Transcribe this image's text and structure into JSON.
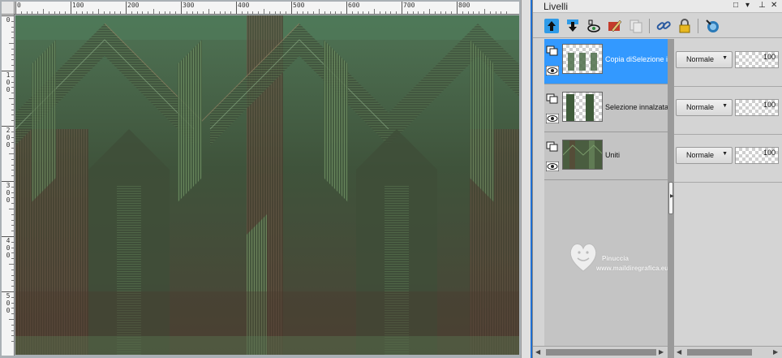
{
  "panel": {
    "title": "Livelli",
    "controls": {
      "options": "□",
      "menu": "▾",
      "pin": "⊥",
      "close": "✕"
    }
  },
  "toolbar": {
    "tools": [
      {
        "icon": "move-layer-up-icon"
      },
      {
        "icon": "move-layer-down-icon"
      },
      {
        "icon": "layer-properties-icon"
      },
      {
        "icon": "edit-selection-icon"
      },
      {
        "icon": "duplicate-layer-icon"
      },
      {
        "icon": "link-layers-icon"
      },
      {
        "icon": "lock-transparency-icon"
      },
      {
        "icon": "layer-mask-icon"
      }
    ]
  },
  "ruler": {
    "top_labels": [
      "0",
      "100",
      "200",
      "300",
      "400",
      "500",
      "600",
      "700",
      "800"
    ],
    "left_labels": [
      "0",
      "100",
      "200",
      "300",
      "400",
      "500"
    ]
  },
  "layers": [
    {
      "name": "Copia diSelezione innalzata",
      "blend_mode": "Normale",
      "opacity": "100",
      "selected": true
    },
    {
      "name": "Selezione innalzata",
      "blend_mode": "Normale",
      "opacity": "100",
      "selected": false
    },
    {
      "name": "Uniti",
      "blend_mode": "Normale",
      "opacity": "100",
      "selected": false
    }
  ],
  "watermark": {
    "name": "Pinuccia",
    "url": "www.maildiregrafica.eu"
  },
  "colors": {
    "selection": "#3399ff",
    "art_green": "#4e6b48",
    "art_brown": "#5d4334"
  }
}
